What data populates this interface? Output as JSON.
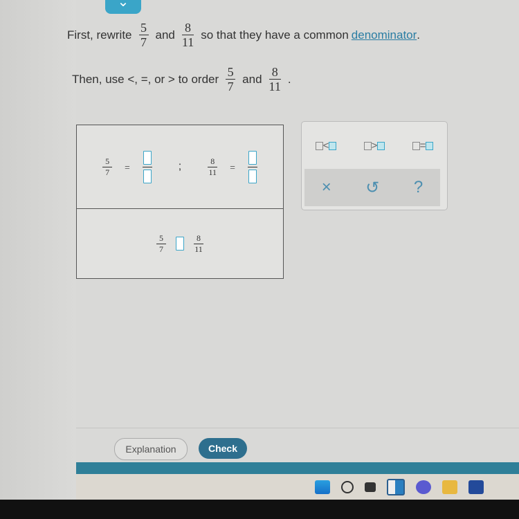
{
  "problem": {
    "line1": {
      "prefix": "First, rewrite",
      "and": "and",
      "suffix": "so that they have a common",
      "link": "denominator",
      "end": "."
    },
    "line2": {
      "prefix": "Then, use <, =, or > to order",
      "and": "and",
      "end": "."
    },
    "fraction_a": {
      "num": "5",
      "den": "7"
    },
    "fraction_b": {
      "num": "8",
      "den": "11"
    }
  },
  "work": {
    "eq1_sep": "=",
    "separator": ";",
    "eq2_sep": "="
  },
  "keypad": {
    "ops": [
      {
        "op": "<"
      },
      {
        "op": ">"
      },
      {
        "op": "="
      }
    ],
    "clear": "×",
    "undo": "↺",
    "help": "?"
  },
  "footer": {
    "explanation": "Explanation",
    "check": "Check"
  },
  "colors": {
    "accent": "#3aa5c8",
    "check_button": "#2e6f8e",
    "band": "#2f7f98"
  }
}
